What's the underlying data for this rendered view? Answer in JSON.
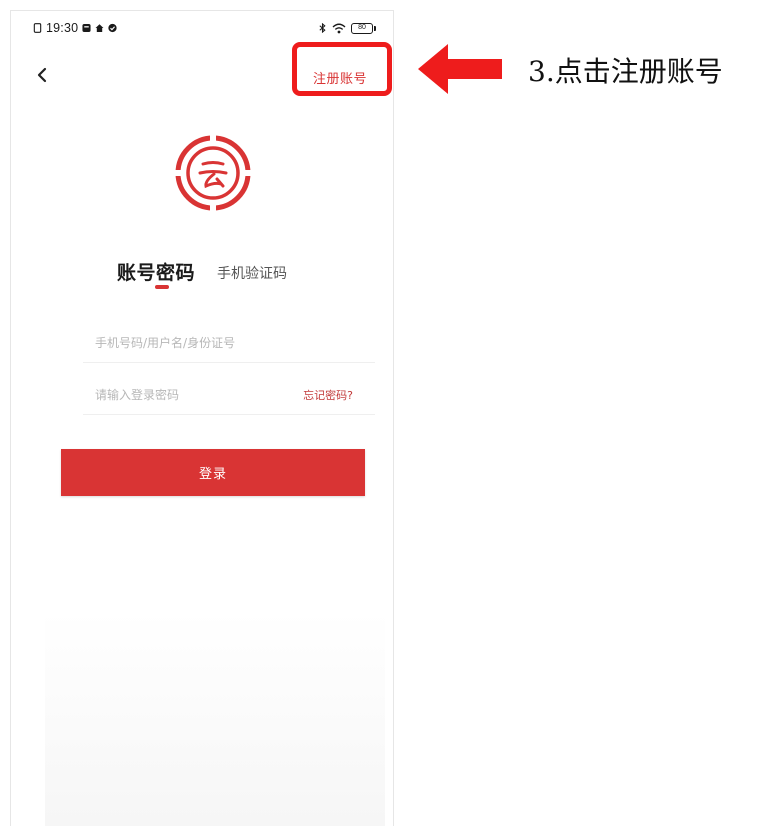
{
  "status_bar": {
    "time": "19:30",
    "battery_label": "80",
    "icons": [
      "sim-icon",
      "notification-icon",
      "home-icon",
      "check-icon",
      "bluetooth-icon",
      "wifi-icon",
      "battery-icon"
    ]
  },
  "nav": {
    "back_icon": "back-arrow-icon",
    "register_label": "注册账号"
  },
  "logo": {
    "icon": "app-logo-icon",
    "brand_color": "#d93434"
  },
  "tabs": {
    "active_label": "账号密码",
    "inactive_label": "手机验证码"
  },
  "form": {
    "account_placeholder": "手机号码/用户名/身份证号",
    "account_value": "",
    "password_placeholder": "请输入登录密码",
    "password_value": "",
    "forgot_label": "忘记密码?"
  },
  "login_button_label": "登录",
  "annotation": {
    "instruction_text": "3.点击注册账号",
    "arrow_icon": "left-arrow-icon",
    "highlight_color": "#ee1c1c"
  },
  "colors": {
    "accent": "#d93434",
    "placeholder": "#b7b7b7"
  }
}
